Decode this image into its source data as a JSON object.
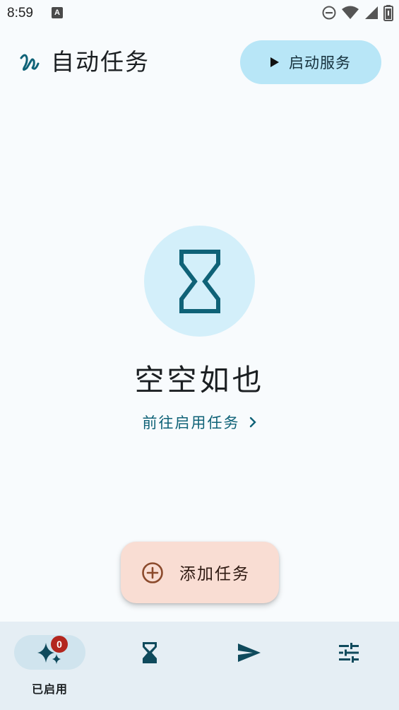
{
  "status_bar": {
    "time": "8:59",
    "notification_icon": "a-notification-icon",
    "icons": [
      "do-not-disturb-icon",
      "wifi-icon",
      "cell-signal-icon",
      "battery-icon"
    ]
  },
  "header": {
    "title": "自动任务",
    "logo_icon": "squiggle-logo-icon",
    "start_service_label": "启动服务",
    "start_service_icon": "play-icon"
  },
  "empty_state": {
    "icon": "hourglass-icon",
    "title": "空空如也",
    "link_label": "前往启用任务",
    "link_icon": "chevron-right-icon"
  },
  "fab": {
    "label": "添加任务",
    "icon": "add-circle-icon"
  },
  "bottom_nav": {
    "items": [
      {
        "label": "已启用",
        "icon": "sparkle-icon",
        "badge": "0",
        "active": true
      },
      {
        "label": "",
        "icon": "hourglass-icon",
        "active": false
      },
      {
        "label": "",
        "icon": "send-icon",
        "active": false
      },
      {
        "label": "",
        "icon": "tune-icon",
        "active": false
      }
    ]
  },
  "colors": {
    "background": "#f8fbfd",
    "primary": "#0f6277",
    "primary_container": "#b8e6f7",
    "empty_circle": "#d3effa",
    "fab_container": "#f9ddd3",
    "fab_icon": "#8b4a2c",
    "nav_background": "#e5eef4",
    "nav_pill": "#d0e4ee",
    "badge": "#b3261e"
  }
}
